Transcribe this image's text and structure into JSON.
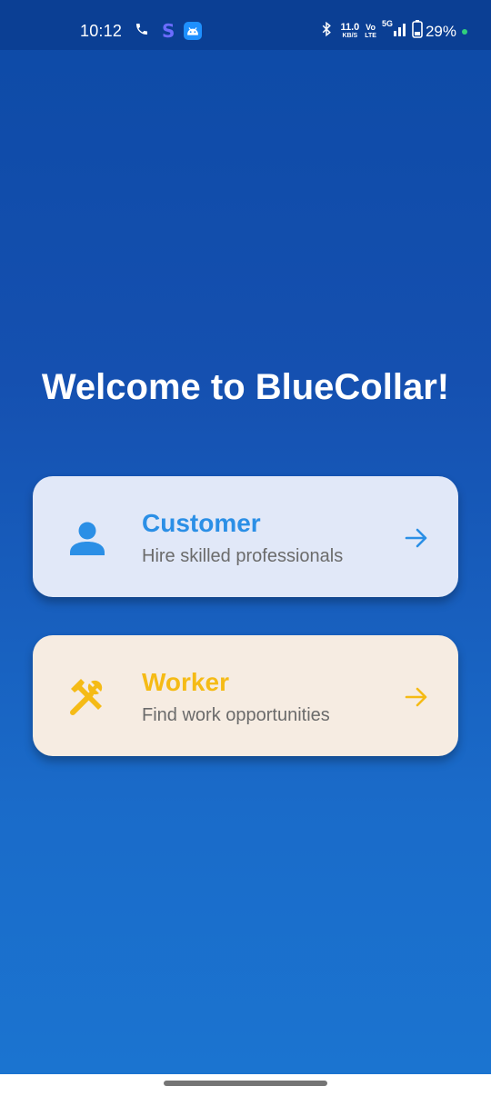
{
  "status_bar": {
    "time": "10:12",
    "app_letter": "S",
    "net_speed": "11.0",
    "net_unit": "KB/S",
    "volte_top": "Vo",
    "volte_bottom": "LTE",
    "network": "5G",
    "battery": "29%",
    "icons": [
      "phone-icon",
      "app-s-icon",
      "android-app-icon",
      "bluetooth-icon",
      "signal-icon",
      "battery-icon"
    ]
  },
  "welcome_title": "Welcome to BlueCollar!",
  "roles": {
    "customer": {
      "title": "Customer",
      "subtitle": "Hire skilled professionals",
      "icon": "person-icon",
      "accent": "#2b8fe6",
      "background": "#e1e8f8"
    },
    "worker": {
      "title": "Worker",
      "subtitle": "Find work opportunities",
      "icon": "tools-icon",
      "accent": "#f5bb16",
      "background": "#f6ece2"
    }
  },
  "colors": {
    "background_top": "#0d4aa6",
    "background_bottom": "#1b74d0",
    "text_light": "#ffffff"
  }
}
